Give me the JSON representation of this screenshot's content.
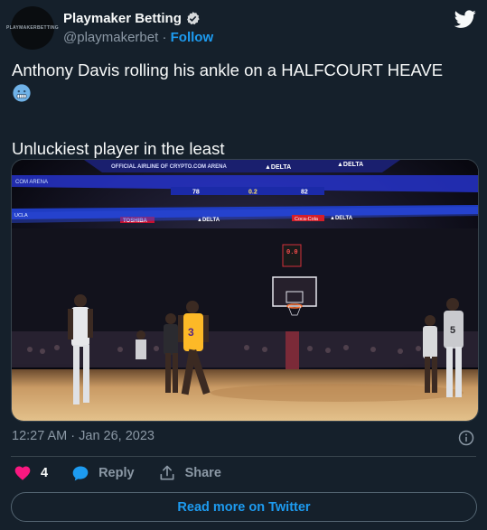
{
  "author": {
    "display_name": "Playmaker Betting",
    "handle": "@playmakerbet",
    "separator": " · ",
    "follow_label": "Follow",
    "avatar_text": "PLAYMAKERBETTING"
  },
  "tweet": {
    "line1": "Anthony Davis rolling his ankle on a HALFCOURT HEAVE",
    "line2": "Unluckiest player in the least",
    "timestamp": "12:27 AM · Jan 26, 2023"
  },
  "actions": {
    "like_count": "4",
    "reply_label": "Reply",
    "share_label": "Share"
  },
  "read_more_label": "Read more on Twitter",
  "video": {
    "arena_top_left": "OFFICIAL AIRLINE OF CRYPTO.COM ARENA",
    "delta_1": "▲DELTA",
    "delta_2": "▲DELTA",
    "com_arena": "COM ARENA",
    "ribbon_left": "UCLA",
    "ribbon_toshiba": "TOSHIBA",
    "ribbon_delta": "▲DELTA",
    "ribbon_cocacola": "Coca-Cola",
    "ribbon_delta2": "▲DELTA",
    "shot_clock": "0.0",
    "score_1": "78",
    "score_2": "0.2",
    "score_3": "82",
    "jersey_1": "3",
    "jersey_2": "5"
  },
  "colors": {
    "background": "#15202b",
    "text": "#f7f9f9",
    "muted": "#8b98a5",
    "accent": "#1d9bf0",
    "heart": "#f91880"
  },
  "icons": [
    "verified-badge-icon",
    "twitter-bird-icon",
    "emoji-icon",
    "info-icon",
    "heart-icon",
    "reply-bubble-icon",
    "share-icon"
  ]
}
